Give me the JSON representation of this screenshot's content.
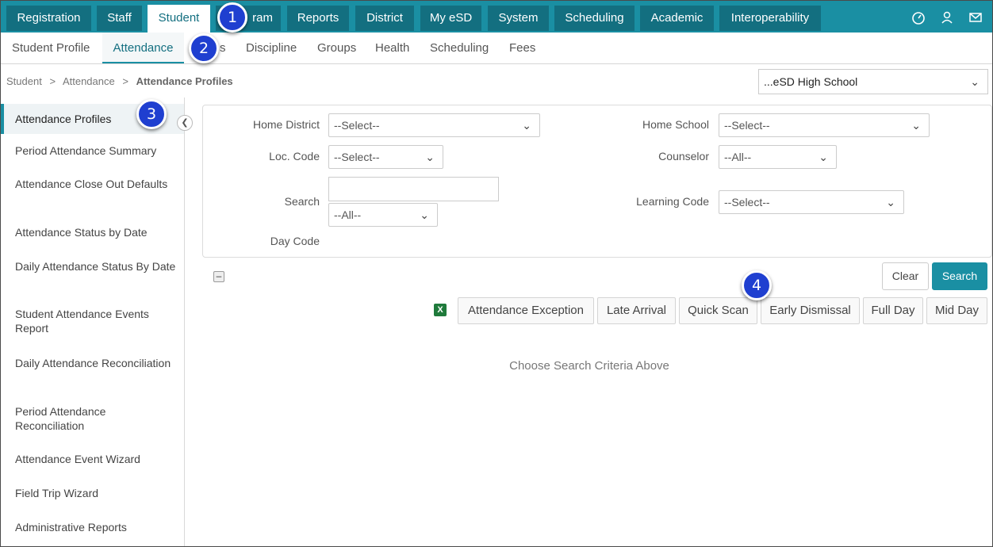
{
  "topnav": {
    "tabs": [
      "Registration",
      "Staff",
      "Student",
      "Program",
      "Reports",
      "District",
      "My eSD",
      "System",
      "Scheduling",
      "Academic",
      "Interoperability"
    ],
    "program_visible_fragment": "ram",
    "active": "Student",
    "icons": [
      "dashboard-icon",
      "user-icon",
      "mail-icon"
    ]
  },
  "subnav": {
    "tabs": [
      "Student Profile",
      "Attendance",
      "s",
      "Discipline",
      "Groups",
      "Health",
      "Scheduling",
      "Fees"
    ],
    "active": "Attendance"
  },
  "breadcrumb": {
    "items": [
      "Student",
      "Attendance",
      "Attendance Profiles"
    ],
    "separator": ">"
  },
  "school_select": {
    "value": "...eSD High School"
  },
  "sidebar": {
    "items": [
      "Attendance Profiles",
      "Period Attendance Summary",
      "Attendance Close Out Defaults",
      "Attendance Status by Date",
      "Daily Attendance Status By Date",
      "Student Attendance Events Report",
      "Daily Attendance Reconciliation",
      "Period Attendance Reconciliation",
      "Attendance Event Wizard",
      "Field Trip Wizard",
      "Administrative Reports"
    ],
    "active": "Attendance Profiles"
  },
  "filters": {
    "home_district": {
      "label": "Home District",
      "value": "--Select--"
    },
    "home_school": {
      "label": "Home School",
      "value": "--Select--"
    },
    "loc_code": {
      "label": "Loc. Code",
      "value": "--Select--"
    },
    "counselor": {
      "label": "Counselor",
      "value": "--All--"
    },
    "search": {
      "label": "Search",
      "value": ""
    },
    "search_scope": {
      "value": "--All--"
    },
    "learning_code": {
      "label": "Learning Code",
      "value": "--Select--"
    },
    "day_code": {
      "label": "Day Code"
    }
  },
  "buttons": {
    "clear": "Clear",
    "search": "Search"
  },
  "actions": [
    "Attendance Exception",
    "Late Arrival",
    "Quick Scan",
    "Early Dismissal",
    "Full Day",
    "Mid Day"
  ],
  "empty_message": "Choose Search Criteria Above",
  "callouts": [
    "1",
    "2",
    "3",
    "4"
  ]
}
